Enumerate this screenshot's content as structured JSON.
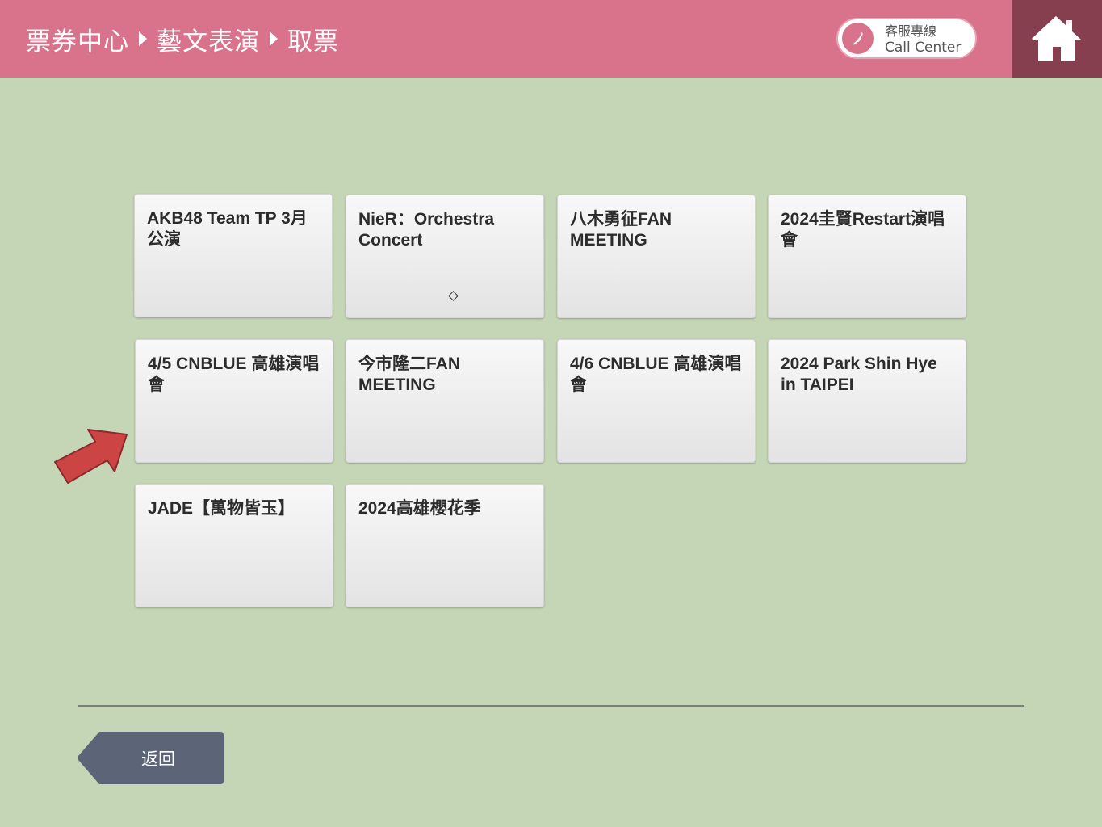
{
  "header": {
    "breadcrumb": [
      "票券中心",
      "藝文表演",
      "取票"
    ],
    "call_center": {
      "line1": "客服專線",
      "line2": "Call Center"
    },
    "home_icon": "house-icon",
    "background": "#d9728b"
  },
  "events": [
    {
      "label": "AKB48 Team TP 3月公演"
    },
    {
      "label": "NieR：Orchestra Concert"
    },
    {
      "label": "八木勇征FAN MEETING"
    },
    {
      "label": "2024圭賢Restart演唱會"
    },
    {
      "label": "4/5 CNBLUE 高雄演唱會"
    },
    {
      "label": "今市隆二FAN MEETING"
    },
    {
      "label": "4/6 CNBLUE 高雄演唱會"
    },
    {
      "label": "2024 Park Shin Hye in TAIPEI"
    },
    {
      "label": "JADE【萬物皆玉】"
    },
    {
      "label": "2024高雄櫻花季"
    }
  ],
  "footer": {
    "back_label": "返回"
  },
  "colors": {
    "page_background": "#c5d6b6",
    "home_button": "#853f4f",
    "back_button": "#5b6577",
    "annotation_arrow": "#cc4444"
  }
}
